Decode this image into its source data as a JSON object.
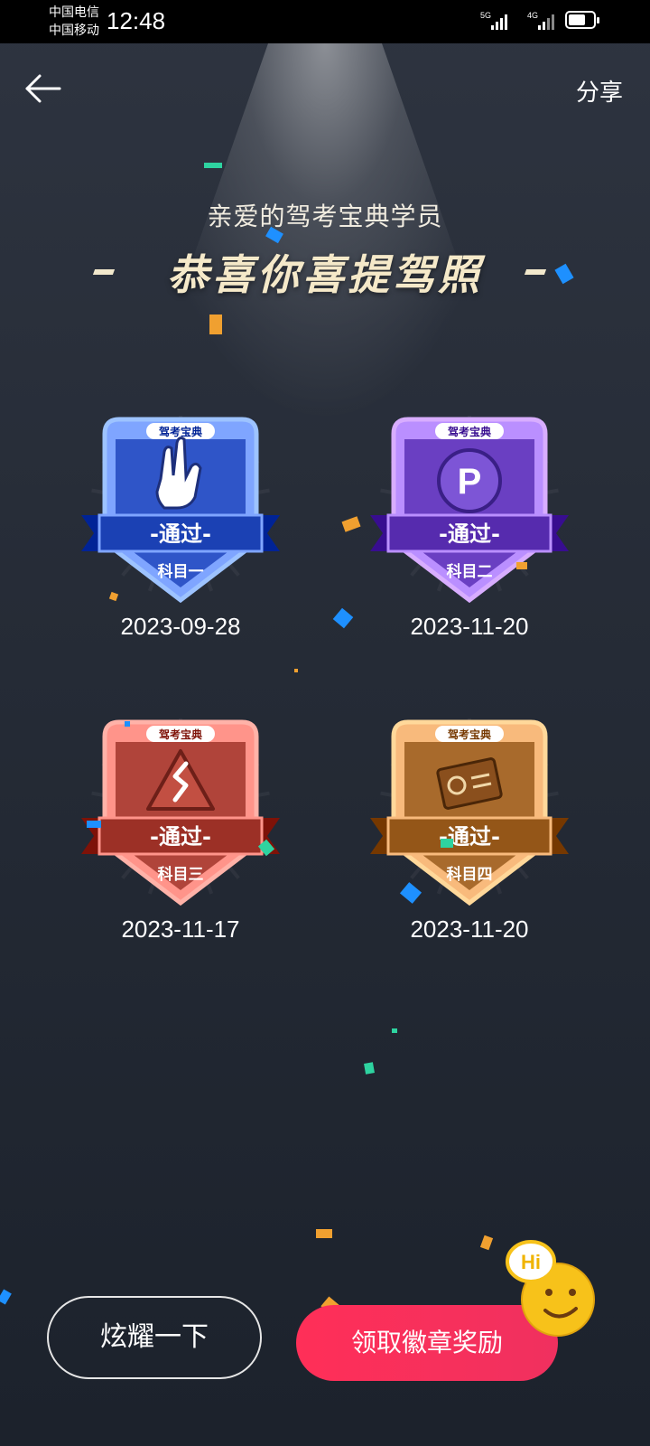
{
  "status_bar": {
    "carrier_1": "中国电信",
    "carrier_2": "中国移动",
    "time": "12:48",
    "network_1": "5G",
    "network_2": "4G",
    "battery_level": 0.7
  },
  "header": {
    "share_label": "分享"
  },
  "greeting": {
    "subtitle": "亲爱的驾考宝典学员",
    "headline": "恭喜你喜提驾照"
  },
  "badges": [
    {
      "brand": "驾考宝典",
      "status": "-通过-",
      "subject": "科目一",
      "date": "2023-09-28",
      "color": "#2f55c8",
      "icon": "victory-hand-icon"
    },
    {
      "brand": "驾考宝典",
      "status": "-通过-",
      "subject": "科目二",
      "date": "2023-11-20",
      "color": "#6a3fc2",
      "icon": "parking-p-icon"
    },
    {
      "brand": "驾考宝典",
      "status": "-通过-",
      "subject": "科目三",
      "date": "2023-11-17",
      "color": "#b0443a",
      "icon": "road-sign-icon"
    },
    {
      "brand": "驾考宝典",
      "status": "-通过-",
      "subject": "科目四",
      "date": "2023-11-20",
      "color": "#a86a2c",
      "icon": "license-card-icon"
    }
  ],
  "actions": {
    "show_off_label": "炫耀一下",
    "claim_label": "领取徽章奖励"
  },
  "mascot": {
    "sign_text": "Hi"
  },
  "colors": {
    "accent": "#ff2f58",
    "headline": "#f5e9c9"
  }
}
